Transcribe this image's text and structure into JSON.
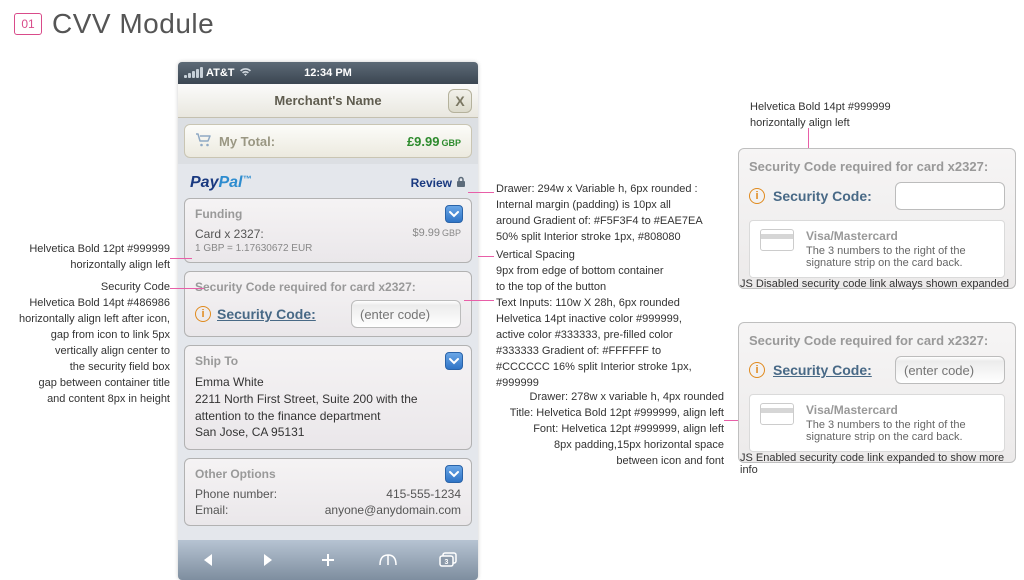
{
  "header": {
    "badge": "01",
    "title": "CVV Module"
  },
  "phone": {
    "status": {
      "carrier": "AT&T",
      "time": "12:34 PM"
    },
    "merchant": "Merchant's Name",
    "close": "X",
    "total": {
      "label": "My Total:",
      "amount": "£9.99",
      "currency": "GBP"
    },
    "brand_review": "Review",
    "funding": {
      "title": "Funding",
      "card_label": "Card x 2327:",
      "amount": "$9.99",
      "amount_currency": "GBP",
      "fx": "1 GBP = 1.17630672 EUR"
    },
    "security": {
      "title": "Security Code required for card x2327:",
      "link": "Security Code:",
      "placeholder": "(enter code)"
    },
    "ship": {
      "title": "Ship To",
      "name": "Emma White",
      "line1": "2211 North First Street, Suite 200 with the",
      "line2": "attention to the finance department",
      "line3": "San Jose, CA 95131"
    },
    "options": {
      "title": "Other Options",
      "phone_label": "Phone number:",
      "phone_value": "415-555-1234",
      "email_label": "Email:",
      "email_value": "anyone@anydomain.com"
    }
  },
  "ann_left_1": "Helvetica Bold 12pt #999999\nhorizontally align left",
  "ann_left_2_title": "Security Code",
  "ann_left_2_body": "Helvetica Bold 14pt #486986\nhorizontally align left after icon,\ngap from icon to link 5px\nvertically align center to\nthe security field box\ngap between container title\nand content 8px in height",
  "ann_mid_1": "Drawer: 294w x Variable h, 6px rounded :\nInternal margin (padding) is 10px all\naround Gradient of: #F5F3F4 to #EAE7EA\n50% split Interior stroke 1px, #808080",
  "ann_mid_2": "Vertical Spacing\n9px from edge of bottom container\nto the top of the button",
  "ann_mid_3": "Text Inputs: 110w X 28h, 6px rounded\nHelvetica 14pt inactive color #999999,\nactive color #333333, pre-filled color\n#333333 Gradient of: #FFFFFF to\n#CCCCCC 16% split Interior stroke 1px,\n#999999",
  "ann_mid_4": "Drawer: 278w x variable h, 4px rounded\nTitle: Helvetica Bold 12pt #999999, align left\nFont: Helvetica 12pt #999999, align left\n8px padding,15px horizontal space\nbetween icon and font",
  "ann_right_1": "Helvetica Bold 14pt #999999\nhorizontally align left",
  "drawer_a": {
    "title": "Security Code required for card x2327:",
    "label": "Security Code:",
    "hint_title": "Visa/Mastercard",
    "hint_body": "The 3 numbers to the right of the\nsignature strip on the card back."
  },
  "caption_a": "JS Disabled security code link always shown expanded",
  "drawer_b": {
    "title": "Security Code required for card x2327:",
    "label": "Security Code:",
    "placeholder": "(enter code)",
    "hint_title": "Visa/Mastercard",
    "hint_body": "The 3 numbers to the right of the\nsignature strip on the card back."
  },
  "caption_b": "JS Enabled security code link expanded to show more info"
}
